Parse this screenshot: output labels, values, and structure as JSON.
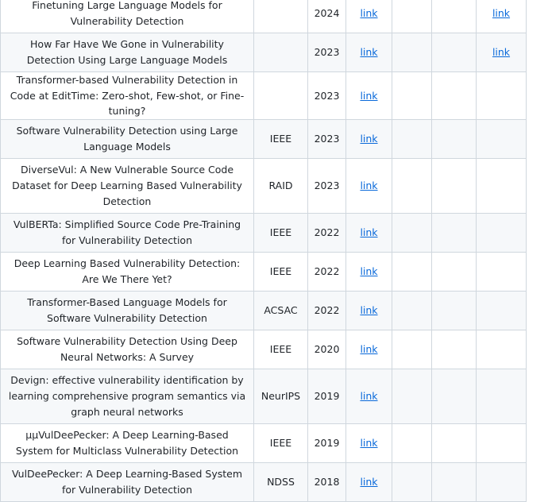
{
  "papers": [
    {
      "title": "Finetuning Large Language Models for Vulnerability Detection",
      "venue": "",
      "year": "2024",
      "paper_link": "link",
      "code_link": "link"
    },
    {
      "title": "How Far Have We Gone in Vulnerability Detection Using Large Language Models",
      "venue": "",
      "year": "2023",
      "paper_link": "link",
      "code_link": "link"
    },
    {
      "title": "Transformer-based Vulnerability Detection in Code at EditTime: Zero-shot, Few-shot, or Fine-tuning?",
      "venue": "",
      "year": "2023",
      "paper_link": "link",
      "code_link": ""
    },
    {
      "title": "Software Vulnerability Detection using Large Language Models",
      "venue": "IEEE",
      "year": "2023",
      "paper_link": "link",
      "code_link": ""
    },
    {
      "title": "DiverseVul: A New Vulnerable Source Code Dataset for Deep Learning Based Vulnerability Detection",
      "venue": "RAID",
      "year": "2023",
      "paper_link": "link",
      "code_link": ""
    },
    {
      "title": "VulBERTa: Simplified Source Code Pre-Training for Vulnerability Detection",
      "venue": "IEEE",
      "year": "2022",
      "paper_link": "link",
      "code_link": ""
    },
    {
      "title": "Deep Learning Based Vulnerability Detection: Are We There Yet?",
      "venue": "IEEE",
      "year": "2022",
      "paper_link": "link",
      "code_link": ""
    },
    {
      "title": "Transformer-Based Language Models for Software Vulnerability Detection",
      "venue": "ACSAC",
      "year": "2022",
      "paper_link": "link",
      "code_link": ""
    },
    {
      "title": "Software Vulnerability Detection Using Deep Neural Networks: A Survey",
      "venue": "IEEE",
      "year": "2020",
      "paper_link": "link",
      "code_link": ""
    },
    {
      "title": "Devign: effective vulnerability identification by learning comprehensive program semantics via graph neural networks",
      "venue": "NeurIPS",
      "year": "2019",
      "paper_link": "link",
      "code_link": ""
    },
    {
      "title": "μμVulDeePecker: A Deep Learning-Based System for Multiclass Vulnerability Detection",
      "venue": "IEEE",
      "year": "2019",
      "paper_link": "link",
      "code_link": ""
    },
    {
      "title": "VulDeePecker: A Deep Learning-Based System for Vulnerability Detection",
      "venue": "NDSS",
      "year": "2018",
      "paper_link": "link",
      "code_link": ""
    }
  ]
}
